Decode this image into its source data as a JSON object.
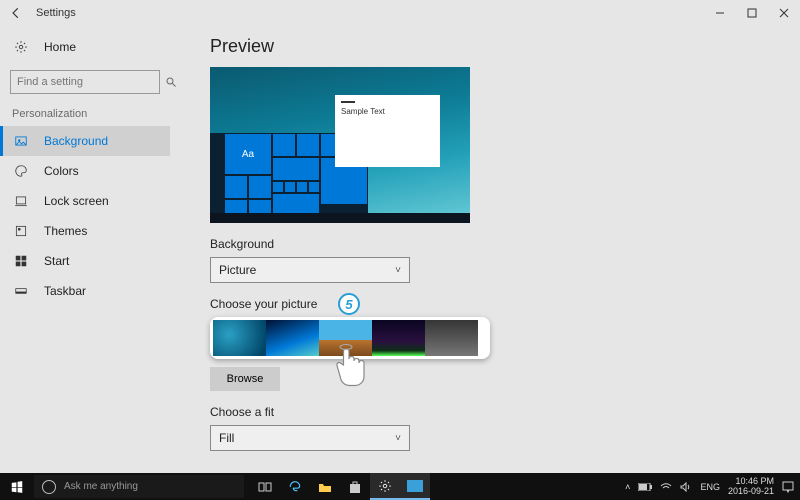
{
  "titlebar": {
    "title": "Settings"
  },
  "sidebar": {
    "home": "Home",
    "search_placeholder": "Find a setting",
    "section": "Personalization",
    "items": [
      {
        "label": "Background"
      },
      {
        "label": "Colors"
      },
      {
        "label": "Lock screen"
      },
      {
        "label": "Themes"
      },
      {
        "label": "Start"
      },
      {
        "label": "Taskbar"
      }
    ]
  },
  "content": {
    "preview_heading": "Preview",
    "sample_text": "Sample Text",
    "tile_aa": "Aa",
    "background_label": "Background",
    "background_value": "Picture",
    "choose_picture_label": "Choose your picture",
    "browse_label": "Browse",
    "fit_label": "Choose a fit",
    "fit_value": "Fill"
  },
  "annotation": {
    "step_number": "5"
  },
  "taskbar": {
    "cortana_placeholder": "Ask me anything",
    "lang": "ENG",
    "time": "10:46 PM",
    "date": "2016-09-21"
  }
}
